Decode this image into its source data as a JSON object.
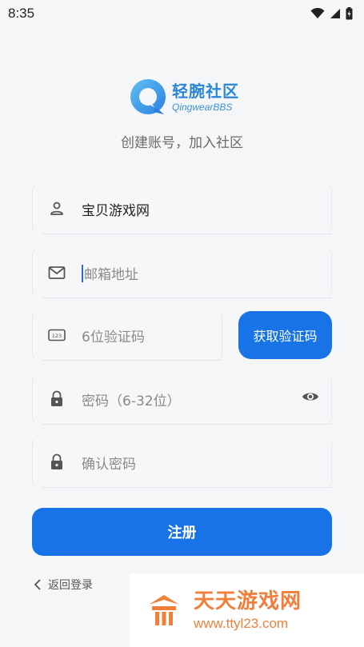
{
  "status_bar": {
    "time": "8:35"
  },
  "logo": {
    "name_cn": "轻腕社区",
    "name_en": "QingwearBBS"
  },
  "subtitle": "创建账号，加入社区",
  "form": {
    "username": {
      "value": "宝贝游戏网",
      "icon": "person-icon"
    },
    "email": {
      "placeholder": "邮箱地址",
      "icon": "mail-icon"
    },
    "code": {
      "placeholder": "6位验证码",
      "icon": "pin-icon",
      "button_label": "获取验证码"
    },
    "password": {
      "placeholder": "密码（6-32位）",
      "icon": "lock-icon",
      "toggle_icon": "eye-icon"
    },
    "confirm_password": {
      "placeholder": "确认密码",
      "icon": "lock-icon"
    }
  },
  "register_button": "注册",
  "back_link": "返回登录",
  "watermark": {
    "name": "天天游戏网",
    "url": "www.ttyl23.com"
  },
  "colors": {
    "primary": "#1773e6",
    "background": "#f5f6f8",
    "watermark": "#f07f3c"
  }
}
